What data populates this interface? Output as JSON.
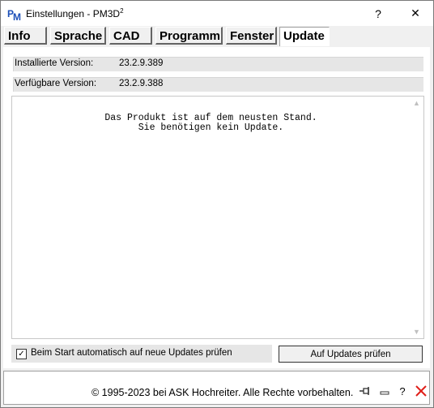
{
  "window": {
    "title": "Einstellungen - PM3D",
    "title_sup": "2",
    "help_glyph": "?",
    "close_glyph": "✕"
  },
  "tabs": [
    {
      "label": "Info",
      "active": false
    },
    {
      "label": "Sprache",
      "active": false
    },
    {
      "label": "CAD",
      "active": false
    },
    {
      "label": "Programm",
      "active": false
    },
    {
      "label": "Fenster",
      "active": false
    },
    {
      "label": "Update",
      "active": true
    }
  ],
  "update": {
    "installed_label": "Installierte Version:",
    "installed_value": "23.2.9.389",
    "available_label": "Verfügbare Version:",
    "available_value": "23.2.9.388",
    "message": "Das Produkt ist auf dem neusten Stand.\nSie benötigen kein Update.",
    "auto_check_label": "Beim Start automatisch auf neue Updates prüfen",
    "auto_check_checked": true,
    "check_button": "Auf Updates prüfen"
  },
  "footer": {
    "copyright": "© 1995-2023 bei ASK Hochreiter. Alle Rechte vorbehalten."
  },
  "icons": {
    "app": "pm-logo-icon",
    "pin": "pin-icon",
    "minimize": "minimize-icon",
    "help": "question-icon",
    "close": "close-icon"
  },
  "colors": {
    "close_red": "#e0201a",
    "app_icon_blue": "#1c4fb8"
  }
}
